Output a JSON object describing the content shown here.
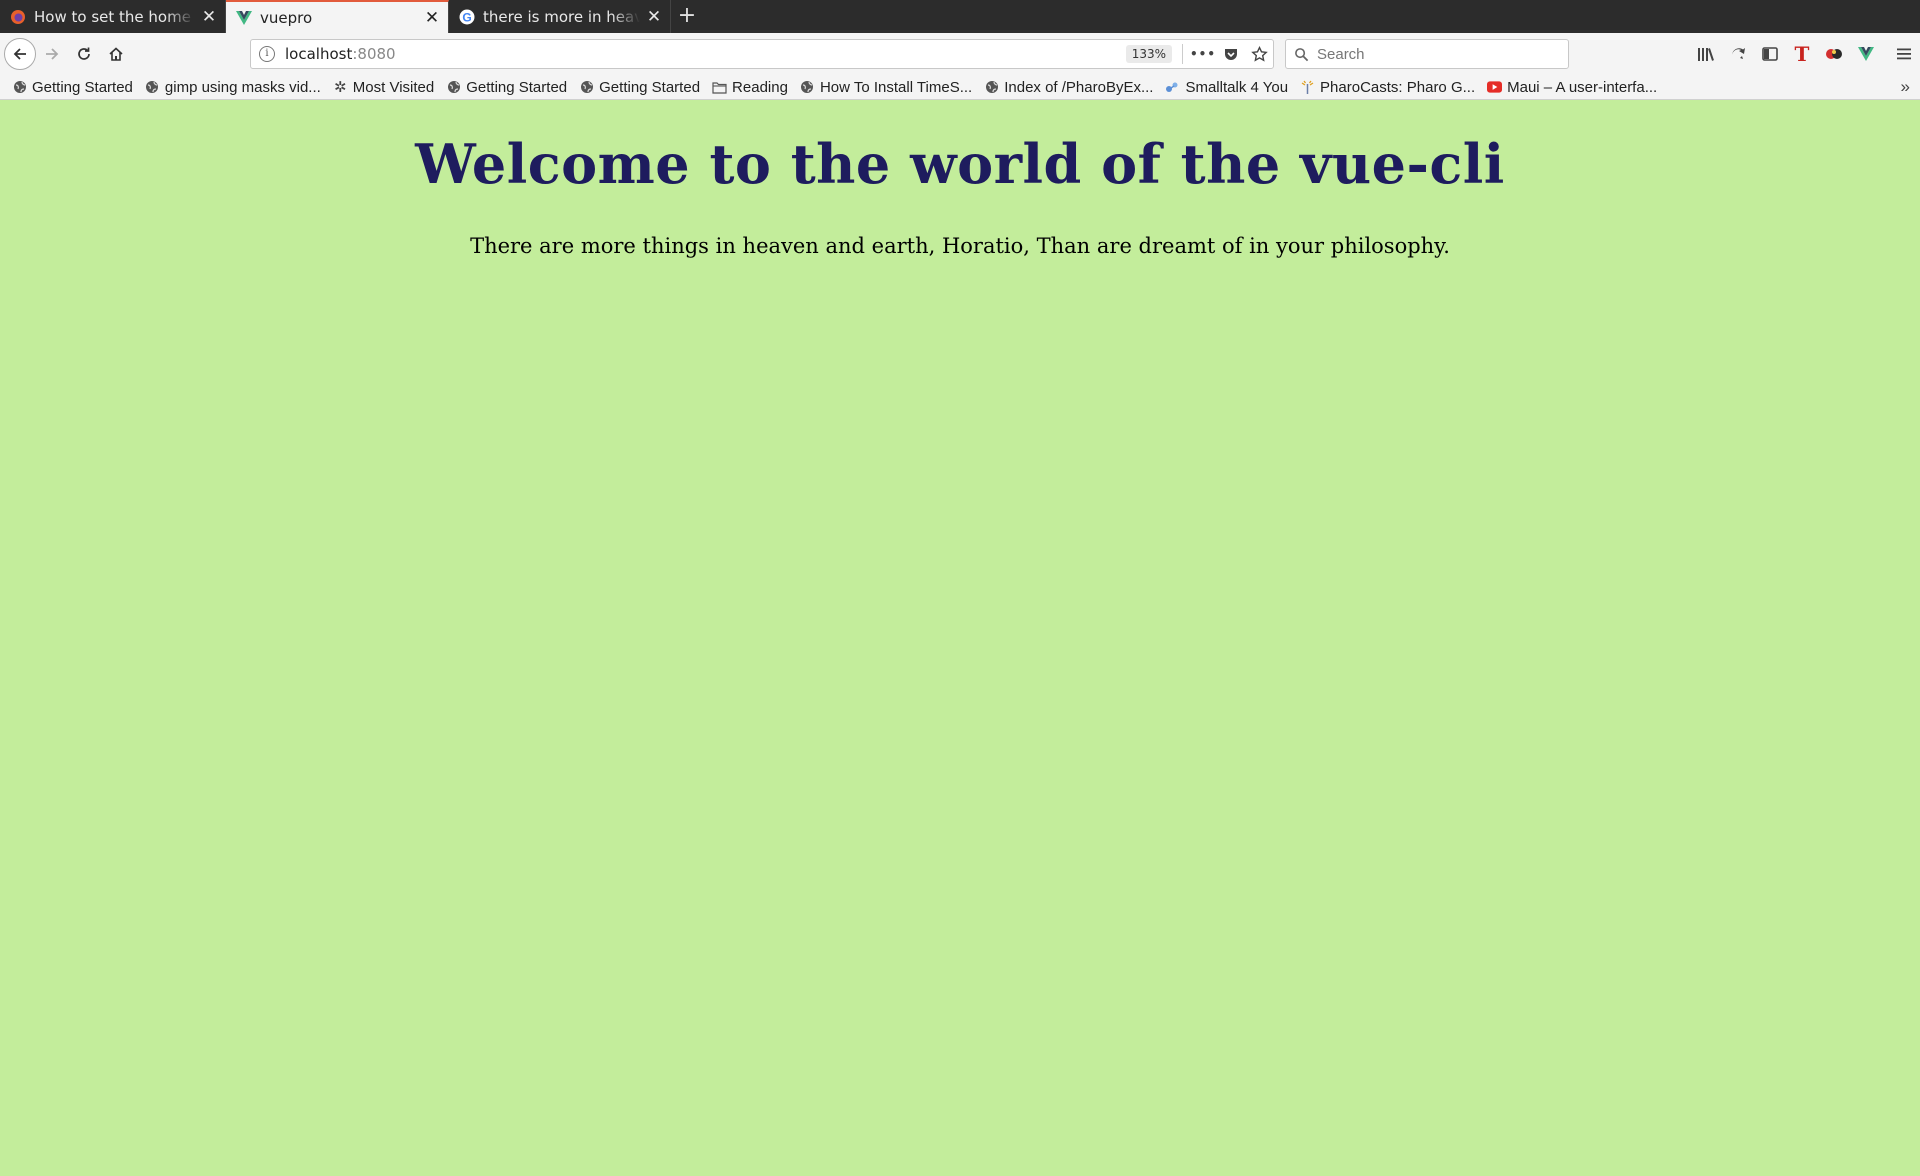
{
  "tabs": [
    {
      "title": "How to set the home page",
      "favicon": "firefox-icon",
      "active": false
    },
    {
      "title": "vuepro",
      "favicon": "vue-icon",
      "active": true
    },
    {
      "title": "there is more in heaven and earth",
      "favicon": "google-icon",
      "active": false
    }
  ],
  "new_tab_label": "+",
  "navbar": {
    "url_host": "localhost",
    "url_port": ":8080",
    "zoom": "133%",
    "page_actions": "•••",
    "search_placeholder": "Search"
  },
  "bookmarks": [
    {
      "label": "Getting Started",
      "icon": "globe-icon"
    },
    {
      "label": "gimp using masks vid...",
      "icon": "globe-icon"
    },
    {
      "label": "Most Visited",
      "icon": "gear-icon"
    },
    {
      "label": "Getting Started",
      "icon": "globe-icon"
    },
    {
      "label": "Getting Started",
      "icon": "globe-icon"
    },
    {
      "label": "Reading",
      "icon": "folder-icon"
    },
    {
      "label": "How To Install TimeS...",
      "icon": "globe-icon"
    },
    {
      "label": "Index of /PharoByEx...",
      "icon": "globe-icon"
    },
    {
      "label": "Smalltalk 4 You",
      "icon": "smalltalk-icon"
    },
    {
      "label": "PharoCasts: Pharo G...",
      "icon": "pharo-icon"
    },
    {
      "label": "Maui – A user-interfa...",
      "icon": "youtube-icon"
    }
  ],
  "bookmarks_overflow": "»",
  "page": {
    "heading": "Welcome to the world of the vue-cli",
    "quote": "There are more things in heaven and earth, Horatio, Than are dreamt of in your philosophy."
  },
  "colors": {
    "page_background": "#c3ed9b",
    "heading": "#1e1c5e",
    "active_tab_accent": "#e25b3c"
  }
}
